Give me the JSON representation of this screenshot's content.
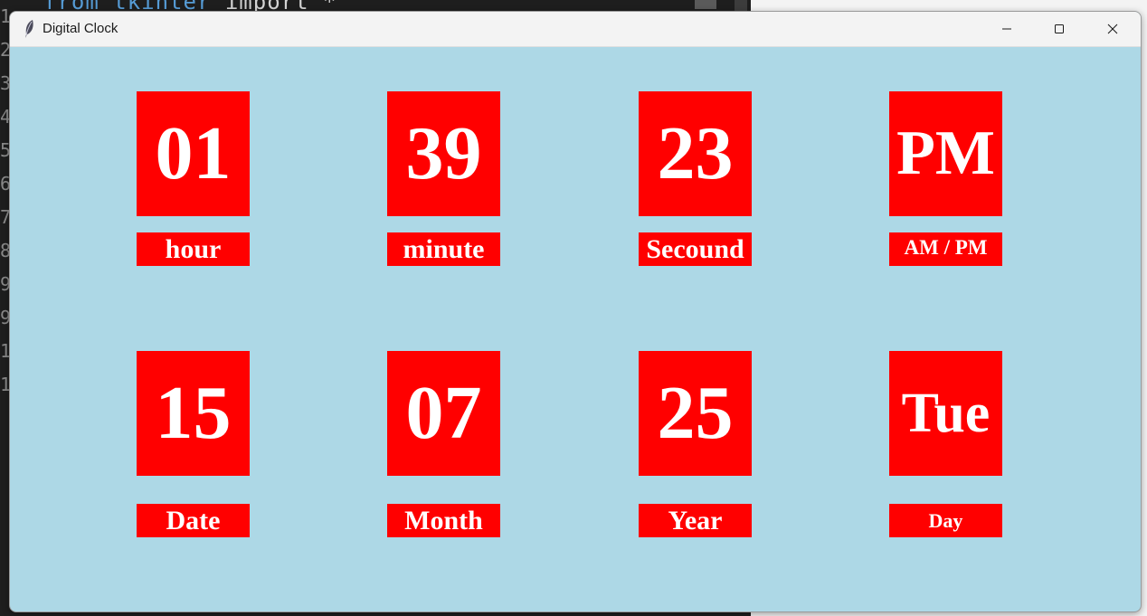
{
  "window": {
    "title": "Digital Clock",
    "background_color": "#add8e6",
    "tile_color": "#ff0000",
    "text_color": "#ffffff",
    "icons": {
      "app": "feather-icon",
      "minimize": "minimize-icon",
      "maximize": "maximize-icon",
      "close": "close-icon"
    }
  },
  "background_editor": {
    "code_fragment_1": "from tkinter",
    "code_fragment_2": "import *"
  },
  "time_row": [
    {
      "value": "01",
      "label": "hour"
    },
    {
      "value": "39",
      "label": "minute"
    },
    {
      "value": "23",
      "label": "Secound"
    },
    {
      "value": "PM",
      "label": "AM / PM"
    }
  ],
  "date_row": [
    {
      "value": "15",
      "label": "Date"
    },
    {
      "value": "07",
      "label": "Month"
    },
    {
      "value": "25",
      "label": "Year"
    },
    {
      "value": "Tue",
      "label": "Day"
    }
  ]
}
